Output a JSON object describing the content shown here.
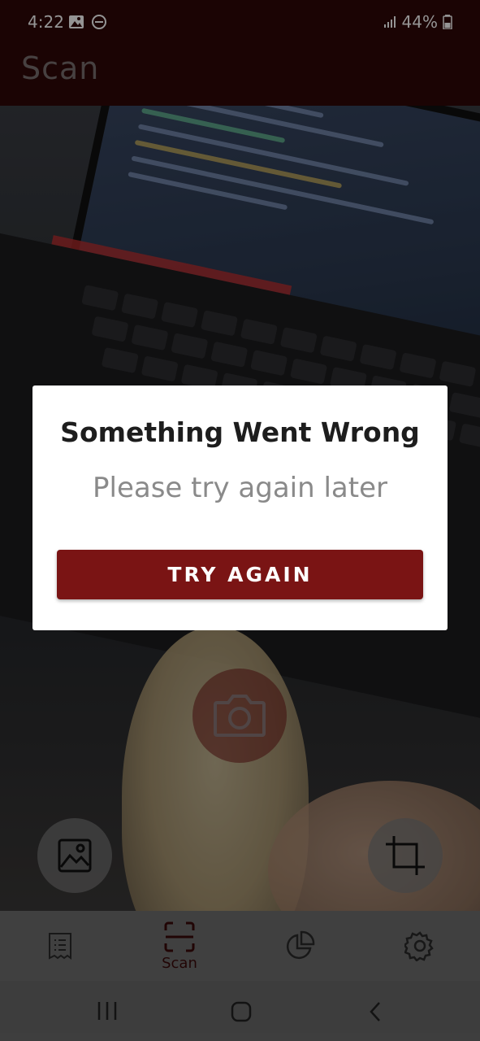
{
  "status_bar": {
    "time": "4:22",
    "battery": "44%"
  },
  "app_bar": {
    "title": "Scan"
  },
  "dialog": {
    "title": "Something Went Wrong",
    "message": "Please try again later",
    "button_label": "TRY AGAIN"
  },
  "camera": {
    "shutter_icon": "camera-icon",
    "gallery_icon": "image-icon",
    "crop_icon": "crop-icon"
  },
  "bottom_nav": {
    "active_index": 1,
    "items": [
      {
        "icon": "receipt-icon",
        "label": ""
      },
      {
        "icon": "scan-icon",
        "label": "Scan"
      },
      {
        "icon": "pie-chart-icon",
        "label": ""
      },
      {
        "icon": "gear-icon",
        "label": ""
      }
    ]
  },
  "colors": {
    "brand": "#7a1414",
    "app_bar": "#2f0808",
    "nav_active": "#3a0a0a"
  }
}
